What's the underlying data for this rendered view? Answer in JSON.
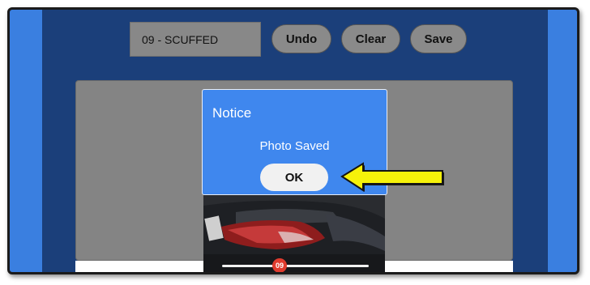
{
  "toolbar": {
    "tag_value": "09 - SCUFFED",
    "undo_label": "Undo",
    "clear_label": "Clear",
    "save_label": "Save"
  },
  "photo": {
    "tag_number": "09"
  },
  "dialog": {
    "title": "Notice",
    "message": "Photo Saved",
    "ok_label": "OK"
  },
  "colors": {
    "app_bg": "#1b3f7a",
    "outer_bg": "#3a7fe0",
    "dialog_bg": "#3f87ee",
    "button_gray": "#8a8a8a",
    "arrow_yellow": "#f6f20a",
    "tag_red": "#e03b2e"
  }
}
